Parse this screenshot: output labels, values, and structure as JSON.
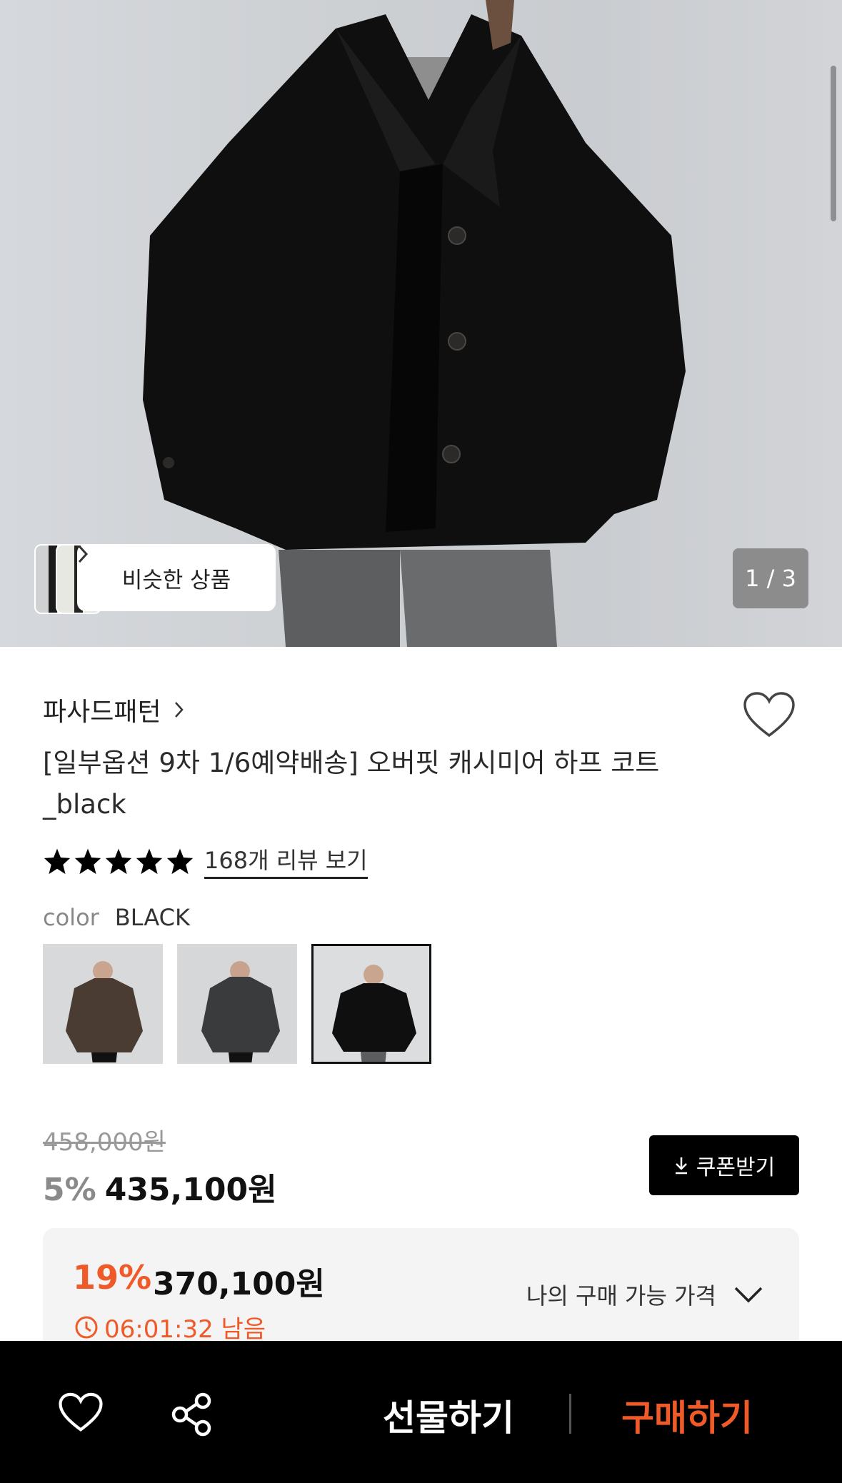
{
  "hero": {
    "similar_label": "비슷한 상품",
    "page_indicator": "1 / 3"
  },
  "product": {
    "brand": "파사드패턴",
    "title": "[일부옵션 9차 1/6예약배송] 오버핏 캐시미어 하프 코트 _black",
    "rating_stars": 5,
    "review_link": "168개 리뷰 보기",
    "color_label": "color",
    "color_value": "BLACK"
  },
  "price": {
    "original": "458,000원",
    "discount_pct": "5%",
    "current": "435,100원",
    "coupon_label": "쿠폰받기"
  },
  "my_price": {
    "discount_pct": "19%",
    "amount": "370,100원",
    "timer": "06:01:32 남음",
    "label": "나의 구매 가능 가격"
  },
  "bottom_bar": {
    "gift_label": "선물하기",
    "buy_label": "구매하기"
  },
  "colors": {
    "accent": "#f05a28",
    "black": "#000000"
  }
}
